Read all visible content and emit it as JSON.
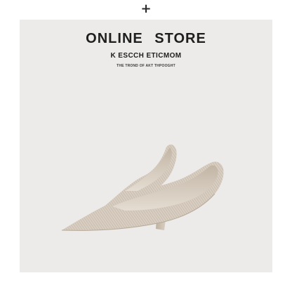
{
  "header": {
    "plus_symbol": "+"
  },
  "banner": {
    "title": "ONLINE STORE",
    "subtitle": "K ESCCH ETICMOM",
    "tagline": "THE TROND OF AKT THPOOGHT"
  },
  "colors": {
    "background": "#ecebe9",
    "shoe_beige": "#d6ccc0",
    "heel_beige": "#cfc3b4",
    "text_dark": "#1e1e1e"
  },
  "product": {
    "icon": "pointed-toe-pump-shoes-image"
  }
}
